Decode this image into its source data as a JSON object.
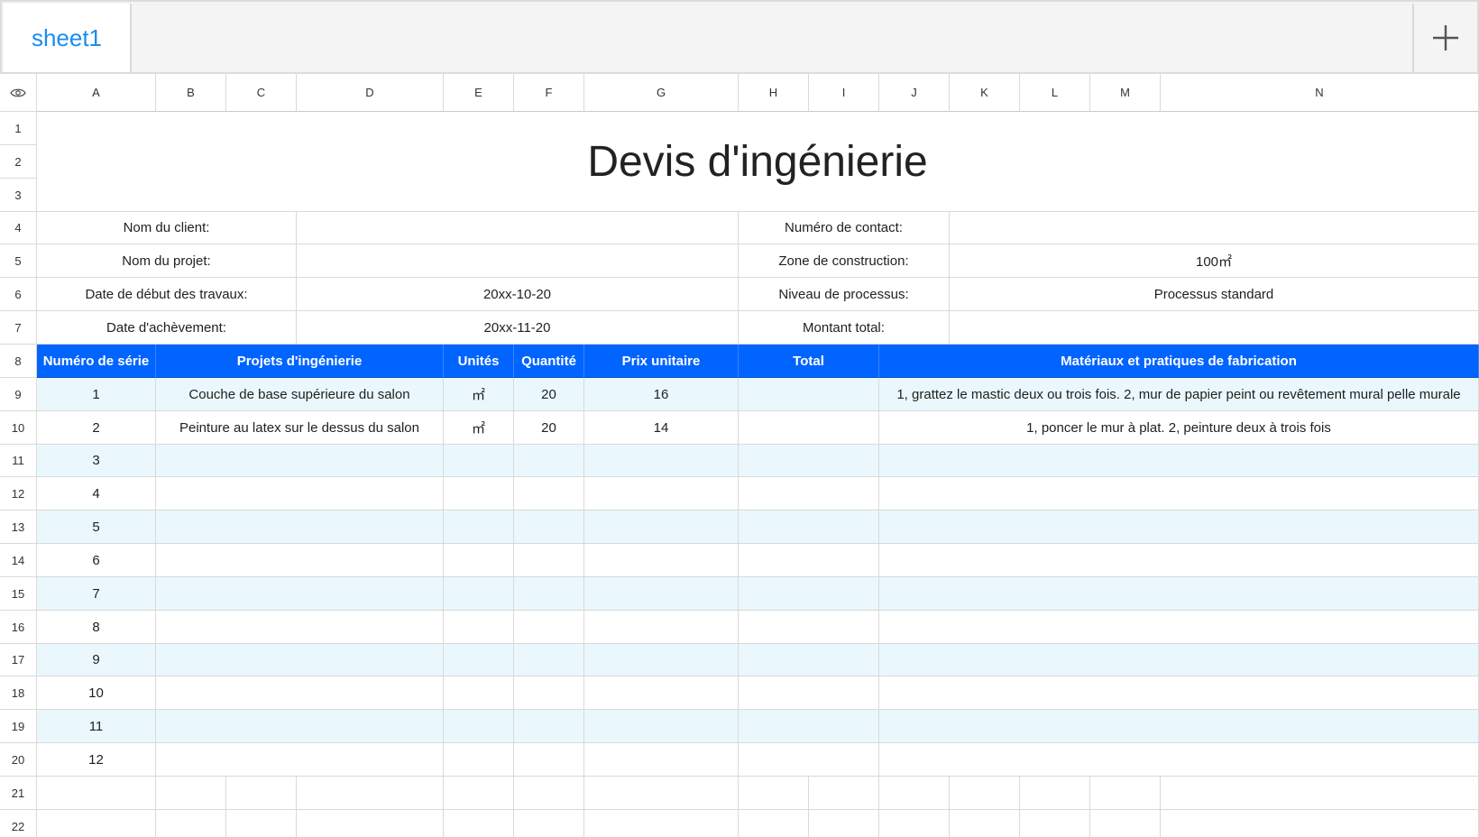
{
  "tabs": {
    "sheet_name": "sheet1",
    "add_icon": "plus-icon"
  },
  "corner_icon": "eye-icon",
  "columns": [
    "A",
    "B",
    "C",
    "D",
    "E",
    "F",
    "G",
    "H",
    "I",
    "J",
    "K",
    "L",
    "M",
    "N"
  ],
  "rows": [
    "1",
    "2",
    "3",
    "4",
    "5",
    "6",
    "7",
    "8",
    "9",
    "10",
    "11",
    "12",
    "13",
    "14",
    "15",
    "16",
    "17",
    "18",
    "19",
    "20",
    "21",
    "22"
  ],
  "title": "Devis d'ingénierie",
  "info": {
    "client_label": "Nom du client:",
    "client_value": "",
    "contact_label": "Numéro de contact:",
    "contact_value": "",
    "project_label": "Nom du projet:",
    "project_value": "",
    "zone_label": "Zone de construction:",
    "zone_value": "100㎡",
    "start_label": "Date de début des travaux:",
    "start_value": "20xx-10-20",
    "process_label": "Niveau de processus:",
    "process_value": "Processus standard",
    "end_label": "Date d'achèvement:",
    "end_value": "20xx-11-20",
    "amount_label": "Montant total:",
    "amount_value": ""
  },
  "table": {
    "headers": {
      "serial": "Numéro de série",
      "project": "Projets d'ingénierie",
      "unit": "Unités",
      "qty": "Quantité",
      "price": "Prix unitaire",
      "total": "Total",
      "materials": "Matériaux et pratiques de fabrication"
    },
    "rows": [
      {
        "serial": "1",
        "project": "Couche de base supérieure du salon",
        "unit": "㎡",
        "qty": "20",
        "price": "16",
        "total": "",
        "materials": "1, grattez le mastic deux ou trois fois. 2, mur de papier peint ou revêtement mural pelle murale"
      },
      {
        "serial": "2",
        "project": "Peinture au latex sur le dessus du salon",
        "unit": "㎡",
        "qty": "20",
        "price": "14",
        "total": "",
        "materials": "1, poncer le mur à plat. 2, peinture deux à trois fois"
      },
      {
        "serial": "3",
        "project": "",
        "unit": "",
        "qty": "",
        "price": "",
        "total": "",
        "materials": ""
      },
      {
        "serial": "4",
        "project": "",
        "unit": "",
        "qty": "",
        "price": "",
        "total": "",
        "materials": ""
      },
      {
        "serial": "5",
        "project": "",
        "unit": "",
        "qty": "",
        "price": "",
        "total": "",
        "materials": ""
      },
      {
        "serial": "6",
        "project": "",
        "unit": "",
        "qty": "",
        "price": "",
        "total": "",
        "materials": ""
      },
      {
        "serial": "7",
        "project": "",
        "unit": "",
        "qty": "",
        "price": "",
        "total": "",
        "materials": ""
      },
      {
        "serial": "8",
        "project": "",
        "unit": "",
        "qty": "",
        "price": "",
        "total": "",
        "materials": ""
      },
      {
        "serial": "9",
        "project": "",
        "unit": "",
        "qty": "",
        "price": "",
        "total": "",
        "materials": ""
      },
      {
        "serial": "10",
        "project": "",
        "unit": "",
        "qty": "",
        "price": "",
        "total": "",
        "materials": ""
      },
      {
        "serial": "11",
        "project": "",
        "unit": "",
        "qty": "",
        "price": "",
        "total": "",
        "materials": ""
      },
      {
        "serial": "12",
        "project": "",
        "unit": "",
        "qty": "",
        "price": "",
        "total": "",
        "materials": ""
      }
    ]
  },
  "colors": {
    "header_bg": "#0164ff",
    "stripe_bg": "#eaf8fd",
    "tab_text": "#1a8cf0"
  }
}
